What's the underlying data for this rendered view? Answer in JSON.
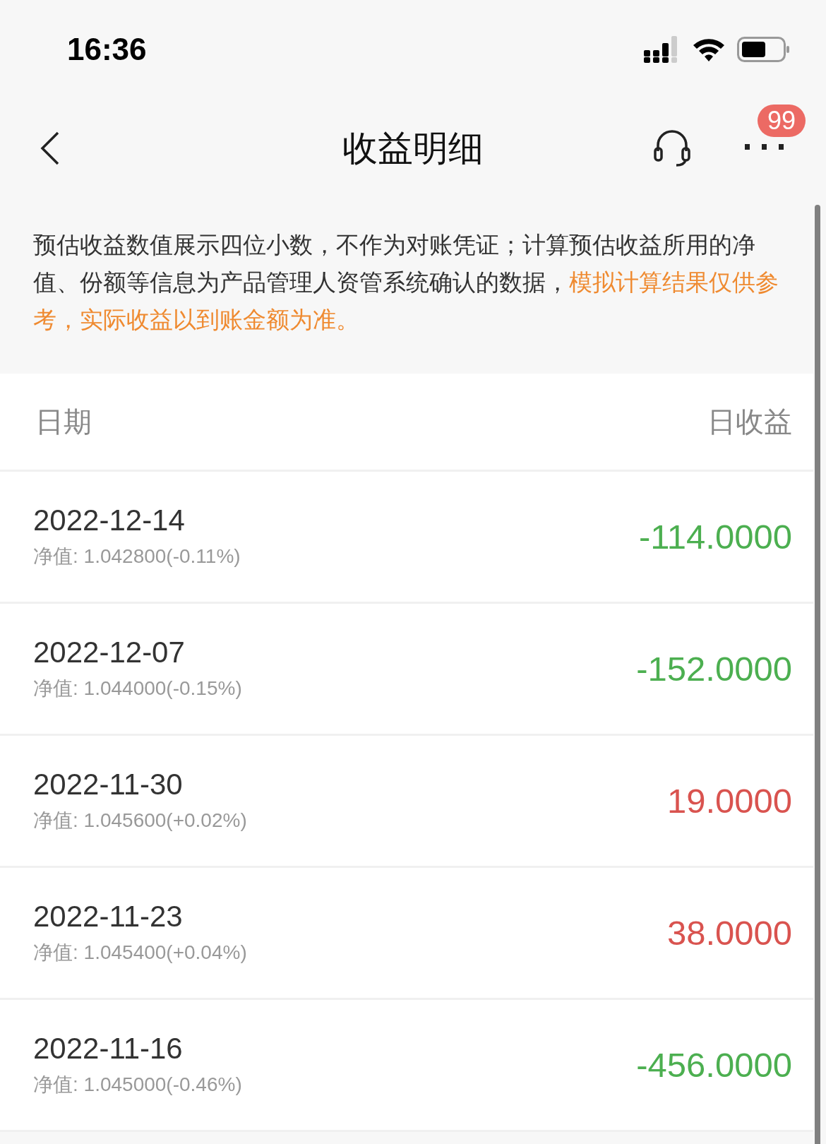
{
  "status_bar": {
    "time": "16:36"
  },
  "nav": {
    "title": "收益明细",
    "badge": "99"
  },
  "notice": {
    "text": "预估收益数值展示四位小数，不作为对账凭证；计算预估收益所用的净值、份额等信息为产品管理人资管系统确认的数据，",
    "highlight": "模拟计算结果仅供参考，实际收益以到账金额为准。"
  },
  "table": {
    "columns": [
      "日期",
      "日收益"
    ],
    "rows": [
      {
        "date": "2022-12-14",
        "nav": "净值: 1.042800(-0.11%)",
        "amount": "-114.0000",
        "color": "#4caf50"
      },
      {
        "date": "2022-12-07",
        "nav": "净值: 1.044000(-0.15%)",
        "amount": "-152.0000",
        "color": "#4caf50"
      },
      {
        "date": "2022-11-30",
        "nav": "净值: 1.045600(+0.02%)",
        "amount": "19.0000",
        "color": "#d9534f"
      },
      {
        "date": "2022-11-23",
        "nav": "净值: 1.045400(+0.04%)",
        "amount": "38.0000",
        "color": "#d9534f"
      },
      {
        "date": "2022-11-16",
        "nav": "净值: 1.045000(-0.46%)",
        "amount": "-456.0000",
        "color": "#4caf50"
      }
    ]
  }
}
